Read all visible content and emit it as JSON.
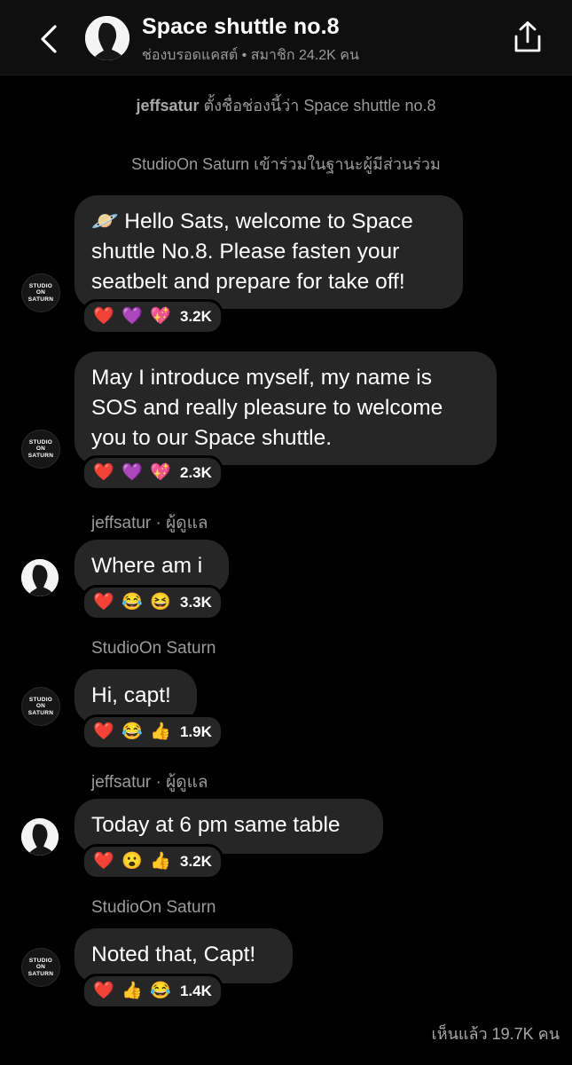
{
  "header": {
    "title": "Space shuttle no.8",
    "subtitle": "ช่องบรอดแคสต์ • สมาชิก 24.2K คน",
    "back_icon": "chevron-left-icon",
    "share_icon": "share-icon"
  },
  "system_messages": [
    {
      "actor": "jeffsatur",
      "text": "ตั้งชื่อช่องนี้ว่า Space shuttle no.8"
    },
    {
      "actor": "",
      "text": "StudioOn Saturn เข้าร่วมในฐานะผู้มีส่วนร่วม"
    }
  ],
  "logo_avatar_text": [
    "STUDIO",
    "ON",
    "SATURN"
  ],
  "messages": [
    {
      "sender": "",
      "lines": [
        "🪐 Hello Sats, welcome to Space",
        "shuttle No.8. Please fasten your",
        "seatbelt and prepare for take off!"
      ],
      "reactions": [
        "❤️",
        "💜",
        "💖"
      ],
      "count": "3.2K"
    },
    {
      "sender": "",
      "lines": [
        "May I introduce myself, my name is",
        "SOS and really pleasure to welcome",
        "you to our Space shuttle."
      ],
      "reactions": [
        "❤️",
        "💜",
        "💖"
      ],
      "count": "2.3K"
    },
    {
      "sender": "jeffsatur · ผู้ดูแล",
      "lines": [
        "Where am i"
      ],
      "reactions": [
        "❤️",
        "😂",
        "😆"
      ],
      "count": "3.3K"
    },
    {
      "sender": "StudioOn Saturn",
      "lines": [
        "Hi, capt!"
      ],
      "reactions": [
        "❤️",
        "😂",
        "👍"
      ],
      "count": "1.9K"
    },
    {
      "sender": "jeffsatur · ผู้ดูแล",
      "lines": [
        "Today at 6 pm same table"
      ],
      "reactions": [
        "❤️",
        "😮",
        "👍"
      ],
      "count": "3.2K"
    },
    {
      "sender": "StudioOn Saturn",
      "lines": [
        "Noted that, Capt!"
      ],
      "reactions": [
        "❤️",
        "👍",
        "😂"
      ],
      "count": "1.4K"
    }
  ],
  "seen": "เห็นแล้ว 19.7K คน"
}
